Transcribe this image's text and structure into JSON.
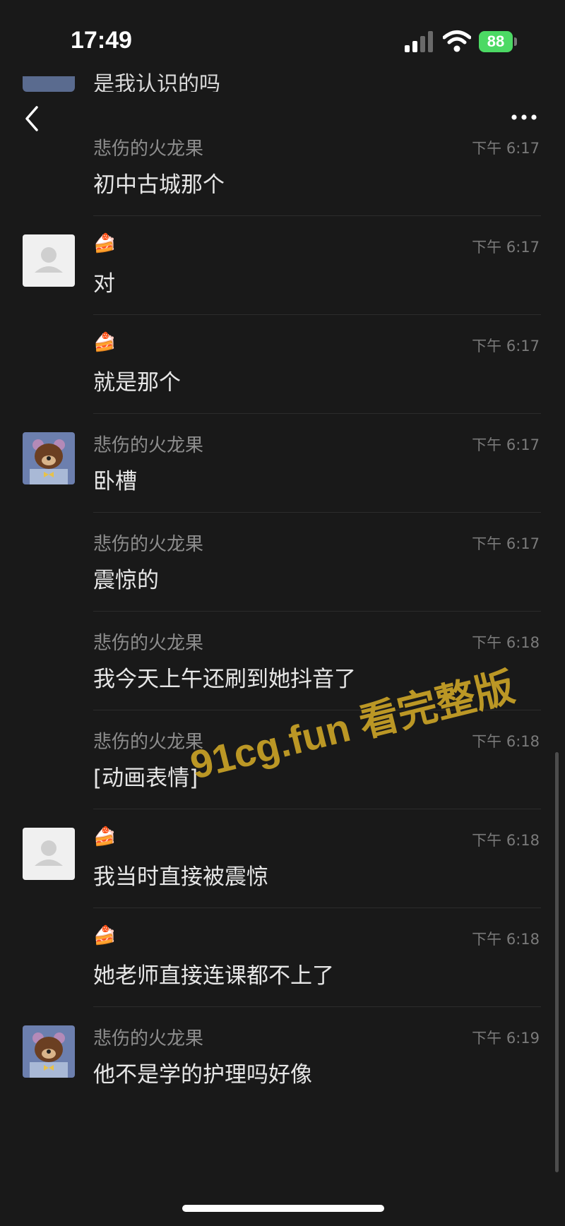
{
  "status": {
    "time": "17:49",
    "battery": "88"
  },
  "partial_message": {
    "text": "是我认识的吗"
  },
  "messages": [
    {
      "name": "悲伤的火龙果",
      "time": "下午 6:17",
      "content": "初中古城那个",
      "avatar": "none"
    },
    {
      "name": "🍰",
      "time": "下午 6:17",
      "content": "对",
      "avatar": "default"
    },
    {
      "name": "🍰",
      "time": "下午 6:17",
      "content": "就是那个",
      "avatar": "none"
    },
    {
      "name": "悲伤的火龙果",
      "time": "下午 6:17",
      "content": "卧槽",
      "avatar": "bear"
    },
    {
      "name": "悲伤的火龙果",
      "time": "下午 6:17",
      "content": "震惊的",
      "avatar": "none"
    },
    {
      "name": "悲伤的火龙果",
      "time": "下午 6:18",
      "content": "我今天上午还刷到她抖音了",
      "avatar": "none"
    },
    {
      "name": "悲伤的火龙果",
      "time": "下午 6:18",
      "content": "[动画表情]",
      "avatar": "none"
    },
    {
      "name": "🍰",
      "time": "下午 6:18",
      "content": "我当时直接被震惊",
      "avatar": "default"
    },
    {
      "name": "🍰",
      "time": "下午 6:18",
      "content": "她老师直接连课都不上了",
      "avatar": "none"
    },
    {
      "name": "悲伤的火龙果",
      "time": "下午 6:19",
      "content": "他不是学的护理吗好像",
      "avatar": "bear"
    }
  ],
  "watermark": "91cg.fun 看完整版",
  "colors": {
    "background": "#191919",
    "battery": "#4cd964",
    "watermark": "#c9a227"
  }
}
